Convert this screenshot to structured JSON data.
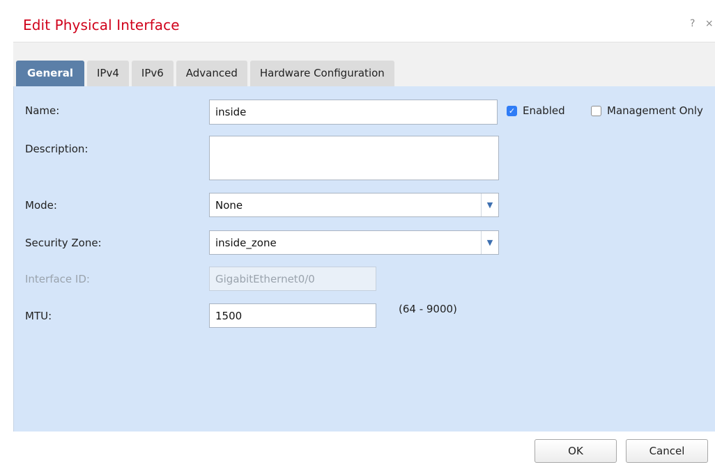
{
  "dialog": {
    "title": "Edit Physical Interface",
    "help_glyph": "?",
    "close_glyph": "×"
  },
  "tabs": [
    {
      "label": "General",
      "active": true
    },
    {
      "label": "IPv4",
      "active": false
    },
    {
      "label": "IPv6",
      "active": false
    },
    {
      "label": "Advanced",
      "active": false
    },
    {
      "label": "Hardware Configuration",
      "active": false
    }
  ],
  "form": {
    "name_label": "Name:",
    "name_value": "inside",
    "enabled_label": "Enabled",
    "enabled_checked": true,
    "management_only_label": "Management Only",
    "management_only_checked": false,
    "description_label": "Description:",
    "description_value": "",
    "mode_label": "Mode:",
    "mode_value": "None",
    "security_zone_label": "Security Zone:",
    "security_zone_value": "inside_zone",
    "interface_id_label": "Interface ID:",
    "interface_id_value": "GigabitEthernet0/0",
    "mtu_label": "MTU:",
    "mtu_value": "1500",
    "mtu_range": "(64 - 9000)"
  },
  "buttons": {
    "ok_label": "OK",
    "cancel_label": "Cancel"
  },
  "colors": {
    "title": "#d0021b",
    "active_tab": "#5b7fa8",
    "panel": "#d5e5f9",
    "checkbox_checked": "#2f7cf6"
  }
}
